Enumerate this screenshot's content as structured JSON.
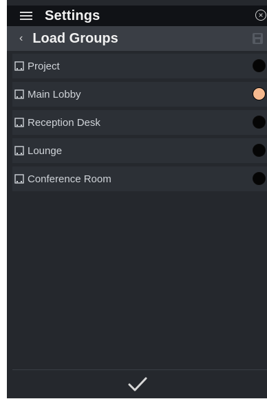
{
  "header": {
    "title": "Settings",
    "menu_icon": "hamburger-icon",
    "close_icon": "close-circle-icon"
  },
  "subheader": {
    "back_symbol": "‹",
    "title": "Load Groups",
    "save_icon": "save-icon"
  },
  "groups": [
    {
      "label": "Project",
      "selected": false
    },
    {
      "label": "Main Lobby",
      "selected": true
    },
    {
      "label": "Reception Desk",
      "selected": false
    },
    {
      "label": "Lounge",
      "selected": false
    },
    {
      "label": "Conference Room",
      "selected": false
    }
  ],
  "footer": {
    "confirm_icon": "checkmark-icon"
  },
  "colors": {
    "background": "#25282d",
    "titlebar": "#101216",
    "subheader": "#3a3e45",
    "row": "#2c3036",
    "selected_indicator": "#f5b98f",
    "unselected_indicator": "#050505"
  }
}
